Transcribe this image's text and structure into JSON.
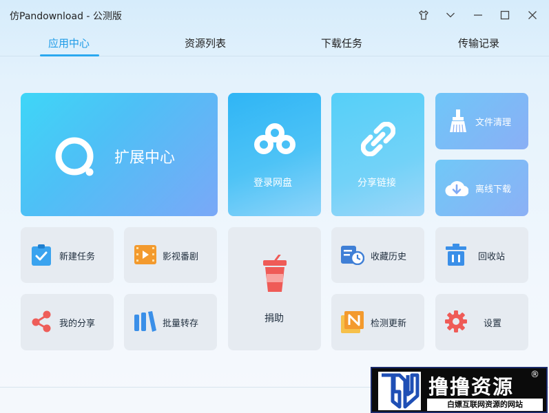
{
  "window": {
    "title": "仿Pandownload - 公测版",
    "controls": [
      "shirt-icon",
      "chevron-down-icon",
      "minimize-icon",
      "maximize-icon",
      "close-icon"
    ]
  },
  "tabs": [
    {
      "label": "应用中心",
      "active": true
    },
    {
      "label": "资源列表",
      "active": false
    },
    {
      "label": "下载任务",
      "active": false
    },
    {
      "label": "传输记录",
      "active": false
    }
  ],
  "tiles": {
    "extension_center": "扩展中心",
    "login_disk": "登录网盘",
    "share_link": "分享链接",
    "file_clean": "文件清理",
    "offline_download": "离线下载",
    "new_task": "新建任务",
    "movies": "影视番剧",
    "my_share": "我的分享",
    "batch_transfer": "批量转存",
    "donate": "捐助",
    "favorites_history": "收藏历史",
    "check_update": "检测更新",
    "recycle_bin": "回收站",
    "settings": "设置"
  },
  "watermark": {
    "title": "撸撸资源",
    "registered": "®",
    "subtitle": "白嫖互联网资源的网站"
  },
  "colors": {
    "accent": "#1e9be7",
    "tile_bg": "#e6ebf1"
  }
}
